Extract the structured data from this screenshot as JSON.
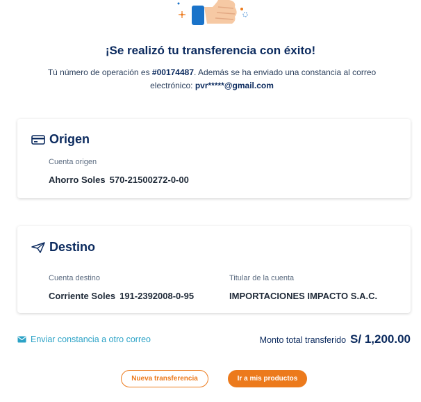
{
  "header": {
    "title": "¡Se realizó tu transferencia con éxito!",
    "subtitle_pre": "Tú número de operación es ",
    "operation_number": "#00174487",
    "subtitle_mid": ". Además se ha enviado una constancia al correo electrónico: ",
    "email": "pvr*****@gmail.com"
  },
  "origin": {
    "title": "Origen",
    "account_label": "Cuenta origen",
    "account_type": "Ahorro Soles",
    "account_number": "570-21500272-0-00"
  },
  "destination": {
    "title": "Destino",
    "account_label": "Cuenta destino",
    "account_type": "Corriente Soles",
    "account_number": "191-2392008-0-95",
    "holder_label": "Titular de la cuenta",
    "holder_name": "IMPORTACIONES IMPACTO S.A.C."
  },
  "footer": {
    "send_link": "Enviar constancia a otro correo",
    "total_label": "Monto total transferido",
    "total_amount": "S/ 1,200.00"
  },
  "buttons": {
    "new_transfer": "Nueva transferencia",
    "my_products": "Ir a mis productos"
  },
  "icons": {
    "hero": "thumbs-up-icon",
    "origin": "credit-card-icon",
    "destination": "paper-plane-icon",
    "send": "envelope-icon"
  },
  "colors": {
    "navy": "#0b2a5e",
    "accent_orange": "#ec7a1c",
    "link_teal": "#2ba2c6"
  }
}
